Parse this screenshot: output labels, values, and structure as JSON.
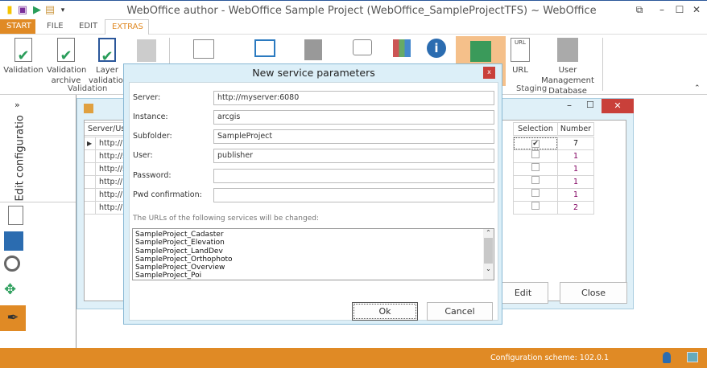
{
  "window": {
    "title": "WebOffice author - WebOffice Sample Project (WebOffice_SampleProjectTFS) ~ WebOffice",
    "controls": [
      "⧉",
      "–",
      "☐",
      "✕"
    ]
  },
  "tabs": [
    {
      "label": "START"
    },
    {
      "label": "FILE"
    },
    {
      "label": "EDIT"
    },
    {
      "label": "EXTRAS"
    }
  ],
  "ribbon": {
    "validation": [
      "Validation",
      "Validation archive",
      "Layer validation"
    ],
    "validation_group": "Validation",
    "url": "URL",
    "user_mgmt": "User Management Database",
    "staging_group": "Staging"
  },
  "left_pane": {
    "title": "Edit configuratio",
    "collapse": "»"
  },
  "grid": {
    "headers": {
      "server": "Server/User",
      "selection": "Selection",
      "number": "Number"
    },
    "rows": [
      {
        "url": "http://m",
        "selected": true,
        "number": "7"
      },
      {
        "url": "http://se",
        "selected": false,
        "number": "1"
      },
      {
        "url": "http://se",
        "selected": false,
        "number": "1"
      },
      {
        "url": "http://m",
        "selected": false,
        "number": "1"
      },
      {
        "url": "http://m",
        "selected": false,
        "number": "1"
      },
      {
        "url": "http://m",
        "selected": false,
        "number": "2"
      }
    ],
    "edit": "Edit",
    "close": "Close"
  },
  "dialog": {
    "title": "New service parameters",
    "close": "x",
    "fields": [
      {
        "label": "Server:",
        "value": "http://myserver:6080"
      },
      {
        "label": "Instance:",
        "value": "arcgis"
      },
      {
        "label": "Subfolder:",
        "value": "SampleProject"
      },
      {
        "label": "User:",
        "value": "publisher"
      },
      {
        "label": "Password:",
        "value": ""
      },
      {
        "label": "Pwd confirmation:",
        "value": ""
      }
    ],
    "caption": "The URLs of the following services will be changed:",
    "services": [
      "SampleProject_Cadaster",
      "SampleProject_Elevation",
      "SampleProject_LandDev",
      "SampleProject_Orthophoto",
      "SampleProject_Overview",
      "SampleProject_Poi"
    ],
    "ok": "Ok",
    "cancel": "Cancel"
  },
  "status": {
    "text": "Configuration scheme:  102.0.1"
  },
  "colors": {
    "accent": "#e08a25",
    "title_blue": "#2b579a",
    "staging_highlight": "#f5c08a",
    "close_red": "#c9403a"
  }
}
